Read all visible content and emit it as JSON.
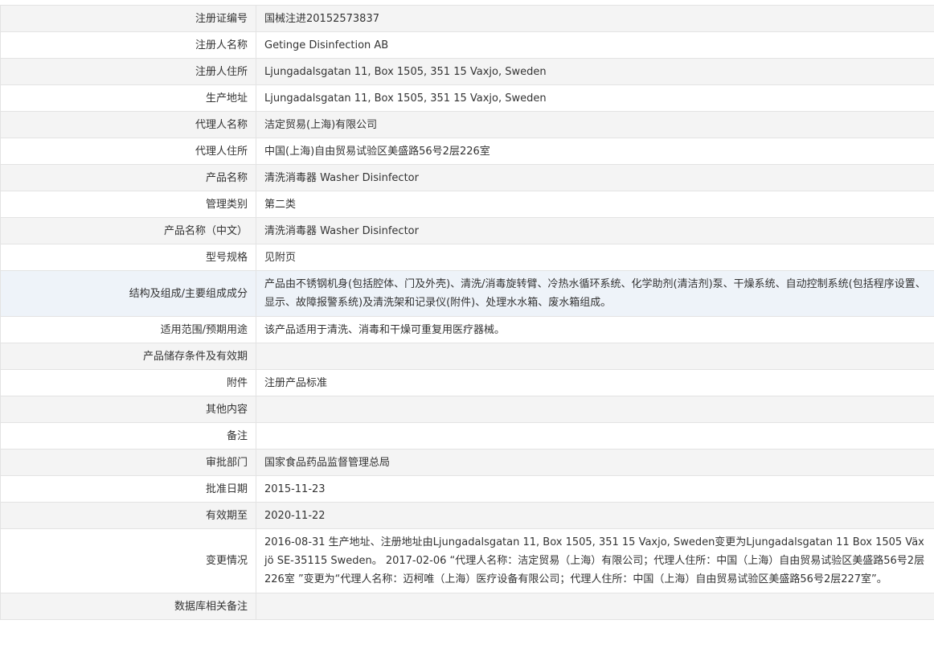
{
  "rows": [
    {
      "label": "注册证编号",
      "value": "国械注进20152573837"
    },
    {
      "label": "注册人名称",
      "value": "Getinge Disinfection AB"
    },
    {
      "label": "注册人住所",
      "value": "Ljungadalsgatan 11, Box 1505, 351 15 Vaxjo, Sweden"
    },
    {
      "label": "生产地址",
      "value": "Ljungadalsgatan 11, Box 1505, 351 15 Vaxjo, Sweden"
    },
    {
      "label": "代理人名称",
      "value": "洁定贸易(上海)有限公司"
    },
    {
      "label": "代理人住所",
      "value": "中国(上海)自由贸易试验区美盛路56号2层226室"
    },
    {
      "label": "产品名称",
      "value": "清洗消毒器 Washer Disinfector"
    },
    {
      "label": "管理类别",
      "value": "第二类"
    },
    {
      "label": "产品名称（中文）",
      "value": "清洗消毒器 Washer Disinfector"
    },
    {
      "label": "型号规格",
      "value": "见附页"
    },
    {
      "label": "结构及组成/主要组成成分",
      "value": "产品由不锈钢机身(包括腔体、门及外壳)、清洗/消毒旋转臂、冷热水循环系统、化学助剂(清洁剂)泵、干燥系统、自动控制系统(包括程序设置、显示、故障报警系统)及清洗架和记录仪(附件)、处理水水箱、废水箱组成。"
    },
    {
      "label": "适用范围/预期用途",
      "value": "该产品适用于清洗、消毒和干燥可重复用医疗器械。"
    },
    {
      "label": "产品储存条件及有效期",
      "value": ""
    },
    {
      "label": "附件",
      "value": "注册产品标准"
    },
    {
      "label": "其他内容",
      "value": ""
    },
    {
      "label": "备注",
      "value": ""
    },
    {
      "label": "审批部门",
      "value": "国家食品药品监督管理总局"
    },
    {
      "label": "批准日期",
      "value": "2015-11-23"
    },
    {
      "label": "有效期至",
      "value": "2020-11-22"
    },
    {
      "label": "变更情况",
      "value": "2016-08-31 生产地址、注册地址由Ljungadalsgatan 11, Box 1505, 351 15 Vaxjo, Sweden变更为Ljungadalsgatan 11 Box 1505 Växjö SE-35115 Sweden。 2017-02-06 “代理人名称：洁定贸易（上海）有限公司；代理人住所：中国（上海）自由贸易试验区美盛路56号2层226室 ”变更为“代理人名称：迈柯唯（上海）医疗设备有限公司；代理人住所：中国（上海）自由贸易试验区美盛路56号2层227室”。"
    },
    {
      "label": "数据库相关备注",
      "value": ""
    }
  ]
}
